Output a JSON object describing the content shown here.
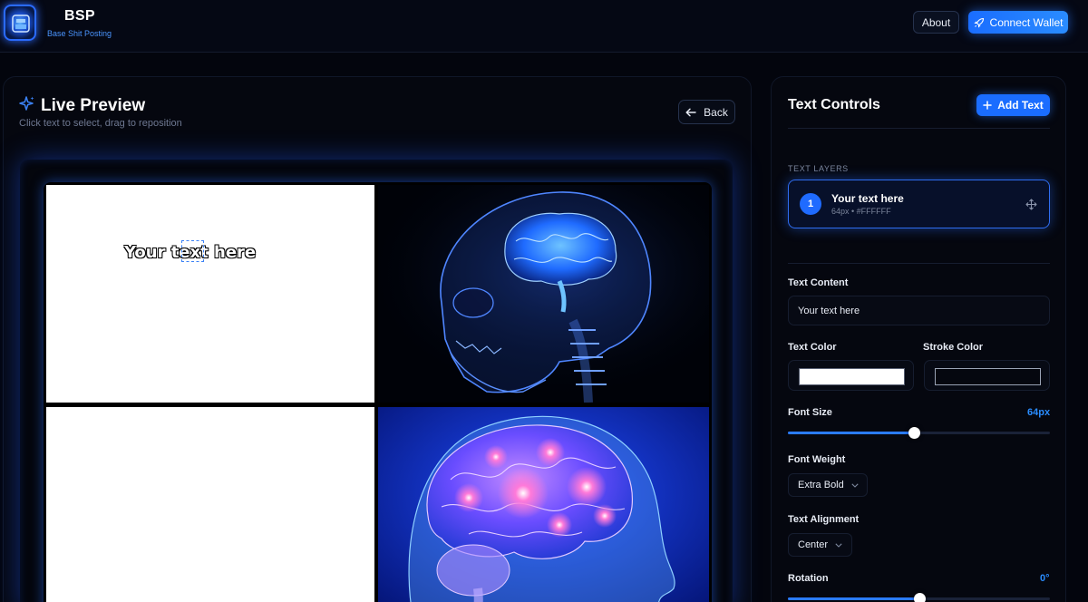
{
  "header": {
    "brand_title": "BSP",
    "brand_subtitle": "Base Shit Posting",
    "about_label": "About",
    "wallet_label": "Connect Wallet"
  },
  "preview": {
    "title": "Live Preview",
    "subtitle": "Click text to select, drag to reposition",
    "back_label": "Back",
    "meme_text": "Your text here"
  },
  "controls": {
    "title": "Text Controls",
    "add_text_label": "Add Text",
    "layers_section_label": "TEXT LAYERS",
    "layers": [
      {
        "index": "1",
        "name": "Your text here",
        "meta": "64px • #FFFFFF"
      }
    ],
    "text_content_label": "Text Content",
    "text_content_value": "Your text here",
    "text_color_label": "Text Color",
    "text_color": "#FFFFFF",
    "stroke_color_label": "Stroke Color",
    "stroke_color": "#FFFFFF",
    "font_size_label": "Font Size",
    "font_size_value": "64px",
    "font_size_fraction": 0.48,
    "font_weight_label": "Font Weight",
    "font_weight_value": "Extra Bold",
    "text_alignment_label": "Text Alignment",
    "text_alignment_value": "Center",
    "rotation_label": "Rotation",
    "rotation_value": "0°",
    "rotation_fraction": 0.5
  },
  "colors": {
    "accent": "#1a6dff",
    "background": "#03050d"
  }
}
